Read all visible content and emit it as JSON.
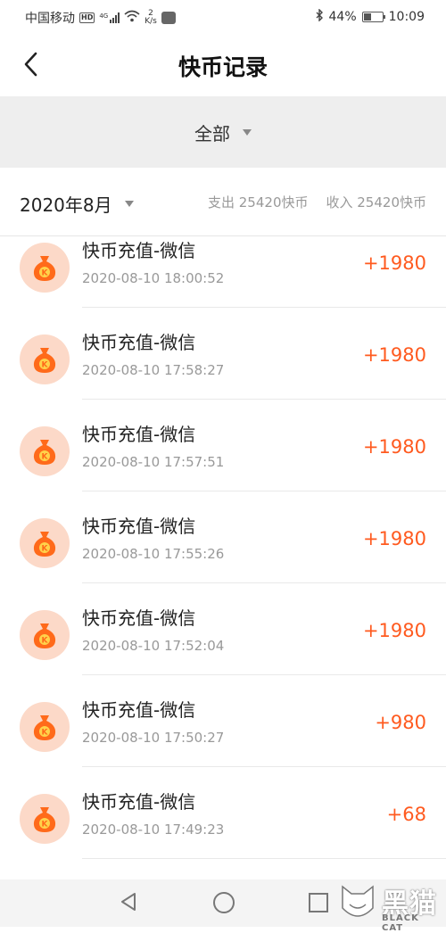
{
  "status_bar": {
    "carrier": "中国移动",
    "hd": "HD",
    "network": "4G",
    "speed_value": "2",
    "speed_unit": "K/s",
    "battery_percent": "44%",
    "battery_level": 0.44,
    "time": "10:09"
  },
  "nav": {
    "title": "快币记录"
  },
  "filter": {
    "label": "全部"
  },
  "month_bar": {
    "month": "2020年8月",
    "expense": "支出 25420快币",
    "income": "收入 25420快币"
  },
  "records": [
    {
      "title": "快币充值-微信",
      "time": "2020-08-10 18:00:52",
      "amount": "+1980"
    },
    {
      "title": "快币充值-微信",
      "time": "2020-08-10 17:58:27",
      "amount": "+1980"
    },
    {
      "title": "快币充值-微信",
      "time": "2020-08-10 17:57:51",
      "amount": "+1980"
    },
    {
      "title": "快币充值-微信",
      "time": "2020-08-10 17:55:26",
      "amount": "+1980"
    },
    {
      "title": "快币充值-微信",
      "time": "2020-08-10 17:52:04",
      "amount": "+1980"
    },
    {
      "title": "快币充值-微信",
      "time": "2020-08-10 17:50:27",
      "amount": "+980"
    },
    {
      "title": "快币充值-微信",
      "time": "2020-08-10 17:49:23",
      "amount": "+68"
    }
  ],
  "coin_icon": {
    "letter": "K",
    "bag_color": "#ff6a1a",
    "circle_color": "#fcd9c8"
  },
  "watermark": {
    "text": "黑猫",
    "sub": "BLACK CAT"
  }
}
